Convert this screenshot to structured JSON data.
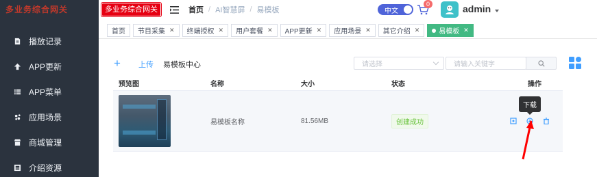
{
  "sidebar": {
    "brand": "多业务综合网关",
    "items": [
      {
        "label": "播放记录",
        "icon": "document-icon"
      },
      {
        "label": "APP更新",
        "icon": "arrow-up-icon"
      },
      {
        "label": "APP菜单",
        "icon": "list-icon"
      },
      {
        "label": "应用场景",
        "icon": "puzzle-icon"
      },
      {
        "label": "商城管理",
        "icon": "shop-icon"
      },
      {
        "label": "介绍资源",
        "icon": "resource-icon"
      }
    ]
  },
  "header": {
    "logo_badge": "多业务综合网关",
    "breadcrumb": {
      "home": "首页",
      "sep": "/",
      "level1": "AI智慧屏",
      "level2": "易模板"
    },
    "lang": "中文",
    "cart_badge": "0",
    "username": "admin"
  },
  "tags": [
    {
      "label": "首页",
      "closable": false,
      "active": false
    },
    {
      "label": "节目采集",
      "closable": true,
      "active": false
    },
    {
      "label": "终端授权",
      "closable": true,
      "active": false
    },
    {
      "label": "用户套餐",
      "closable": true,
      "active": false
    },
    {
      "label": "APP更新",
      "closable": true,
      "active": false
    },
    {
      "label": "应用场景",
      "closable": true,
      "active": false
    },
    {
      "label": "其它介绍",
      "closable": true,
      "active": false
    },
    {
      "label": "易模板",
      "closable": true,
      "active": true
    }
  ],
  "toolbar": {
    "plus": "+",
    "upload": "上传",
    "center": "易模板中心",
    "select_placeholder": "请选择",
    "search_placeholder": "请输入关键字"
  },
  "table": {
    "headers": {
      "preview": "预览图",
      "name": "名称",
      "size": "大小",
      "status": "状态",
      "ops": "操作"
    },
    "rows": [
      {
        "name": "易模板名称",
        "size": "81.56MB",
        "status": "创建成功"
      }
    ]
  },
  "tooltip": "下载",
  "colors": {
    "sidebar_bg": "#2b333e",
    "accent": "#409eff",
    "active_tag": "#42b983",
    "success": "#67c23a",
    "lang_toggle": "#4f64d9",
    "annotation": "#ff0000"
  }
}
